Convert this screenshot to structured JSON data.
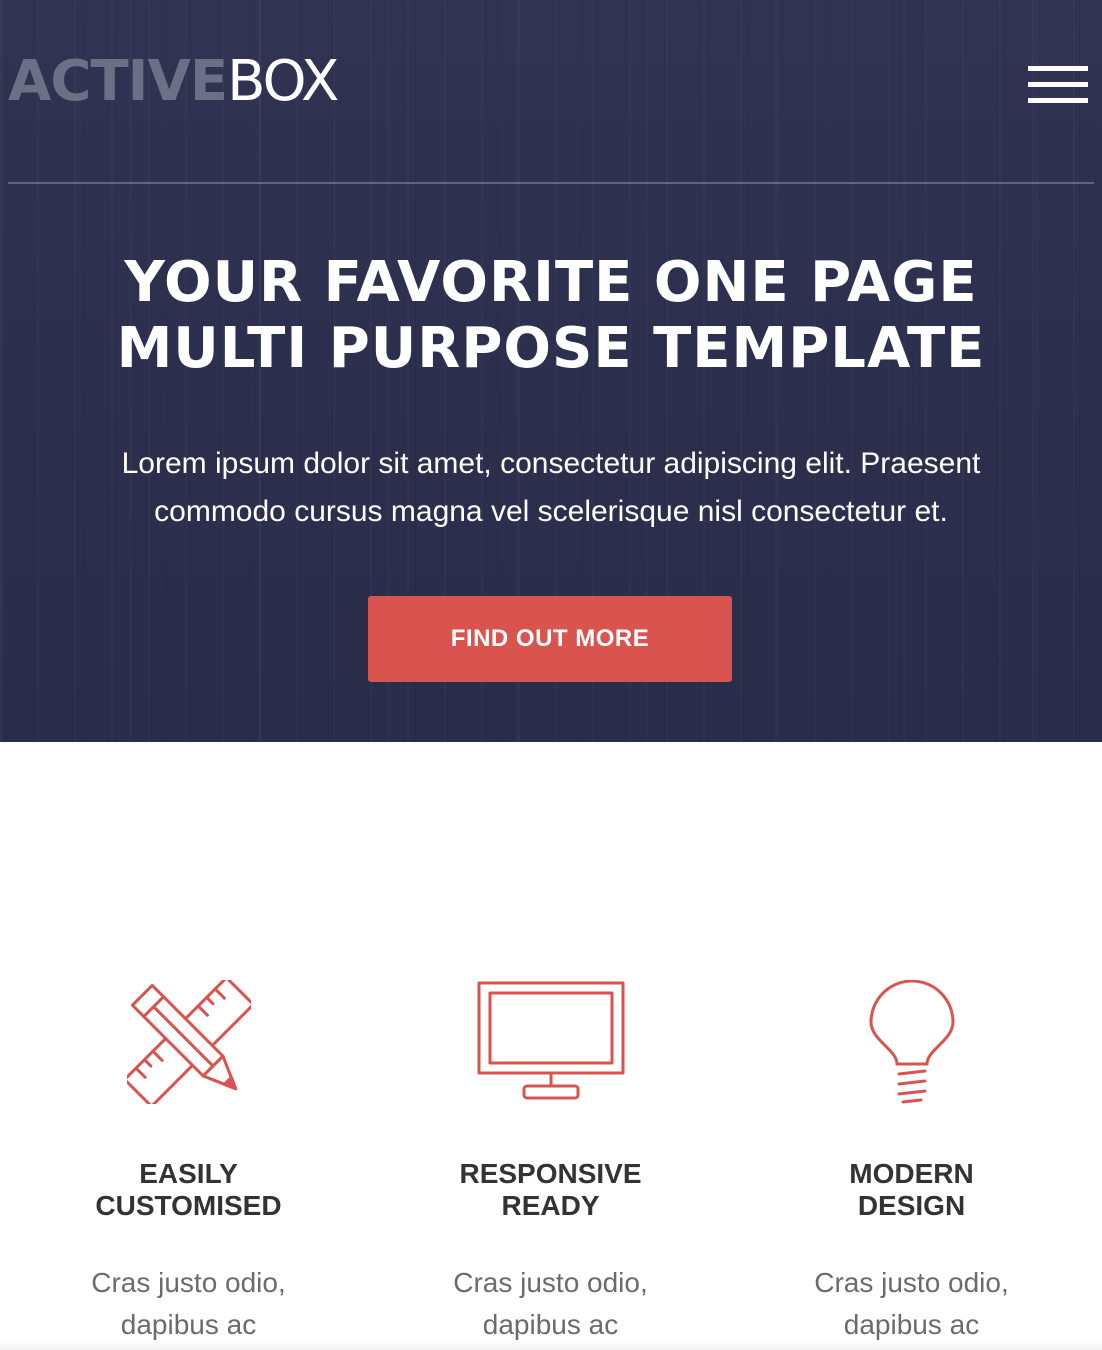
{
  "brand": {
    "logo_strong": "ACTIVE",
    "logo_light": "BOX"
  },
  "nav": {
    "menu_icon": "hamburger-menu-icon"
  },
  "hero": {
    "title": "YOUR FAVORITE ONE PAGE MULTI PURPOSE TEMPLATE",
    "lead": "Lorem ipsum dolor sit amet, consectetur adipiscing elit. Praesent commodo cursus magna vel scelerisque nisl consectetur et.",
    "cta_label": "FIND OUT MORE"
  },
  "features": [
    {
      "icon": "pencil-ruler-icon",
      "title": "EASILY CUSTOMISED",
      "text": "Cras justo odio, dapibus ac"
    },
    {
      "icon": "monitor-icon",
      "title": "RESPONSIVE READY",
      "text": "Cras justo odio, dapibus ac"
    },
    {
      "icon": "lightbulb-icon",
      "title": "MODERN DESIGN",
      "text": "Cras justo odio, dapibus ac"
    }
  ],
  "colors": {
    "hero_background": "#2e3150",
    "accent": "#d9534f",
    "logo_strong": "#6c6f85",
    "heading_text": "#333333",
    "body_text": "#6b6b6b"
  }
}
